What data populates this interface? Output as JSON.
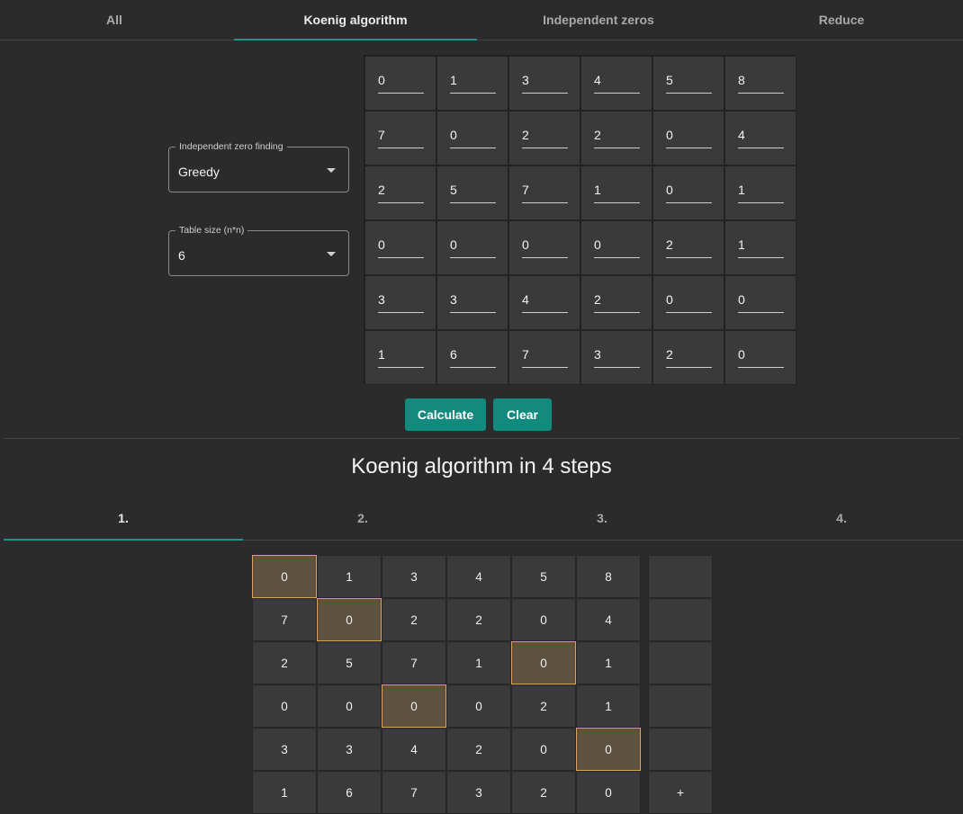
{
  "top_tabs": [
    "All",
    "Koenig algorithm",
    "Independent zeros",
    "Reduce"
  ],
  "active_top_tab": 1,
  "zero_finding": {
    "label": "Independent zero finding",
    "value": "Greedy"
  },
  "table_size": {
    "label": "Table size (n*n)",
    "value": "6"
  },
  "matrix": [
    [
      "0",
      "1",
      "3",
      "4",
      "5",
      "8"
    ],
    [
      "7",
      "0",
      "2",
      "2",
      "0",
      "4"
    ],
    [
      "2",
      "5",
      "7",
      "1",
      "0",
      "1"
    ],
    [
      "0",
      "0",
      "0",
      "0",
      "2",
      "1"
    ],
    [
      "3",
      "3",
      "4",
      "2",
      "0",
      "0"
    ],
    [
      "1",
      "6",
      "7",
      "3",
      "2",
      "0"
    ]
  ],
  "buttons": {
    "calculate": "Calculate",
    "clear": "Clear"
  },
  "result": {
    "title": "Koenig algorithm in 4 steps",
    "step_tabs": [
      "1.",
      "2.",
      "3.",
      "4."
    ],
    "active_step": 0,
    "matrix": [
      [
        "0",
        "1",
        "3",
        "4",
        "5",
        "8"
      ],
      [
        "7",
        "0",
        "2",
        "2",
        "0",
        "4"
      ],
      [
        "2",
        "5",
        "7",
        "1",
        "0",
        "1"
      ],
      [
        "0",
        "0",
        "0",
        "0",
        "2",
        "1"
      ],
      [
        "3",
        "3",
        "4",
        "2",
        "0",
        "0"
      ],
      [
        "1",
        "6",
        "7",
        "3",
        "2",
        "0"
      ]
    ],
    "highlighted": [
      [
        0,
        0
      ],
      [
        1,
        1
      ],
      [
        2,
        4
      ],
      [
        3,
        2
      ],
      [
        4,
        5
      ]
    ],
    "row_marks": [
      "",
      "",
      "",
      "",
      "",
      "+"
    ],
    "highlight_color": "#e0a35a"
  },
  "colors": {
    "accent": "#17988a",
    "button": "#128a7e",
    "background": "#2b2b2b"
  }
}
